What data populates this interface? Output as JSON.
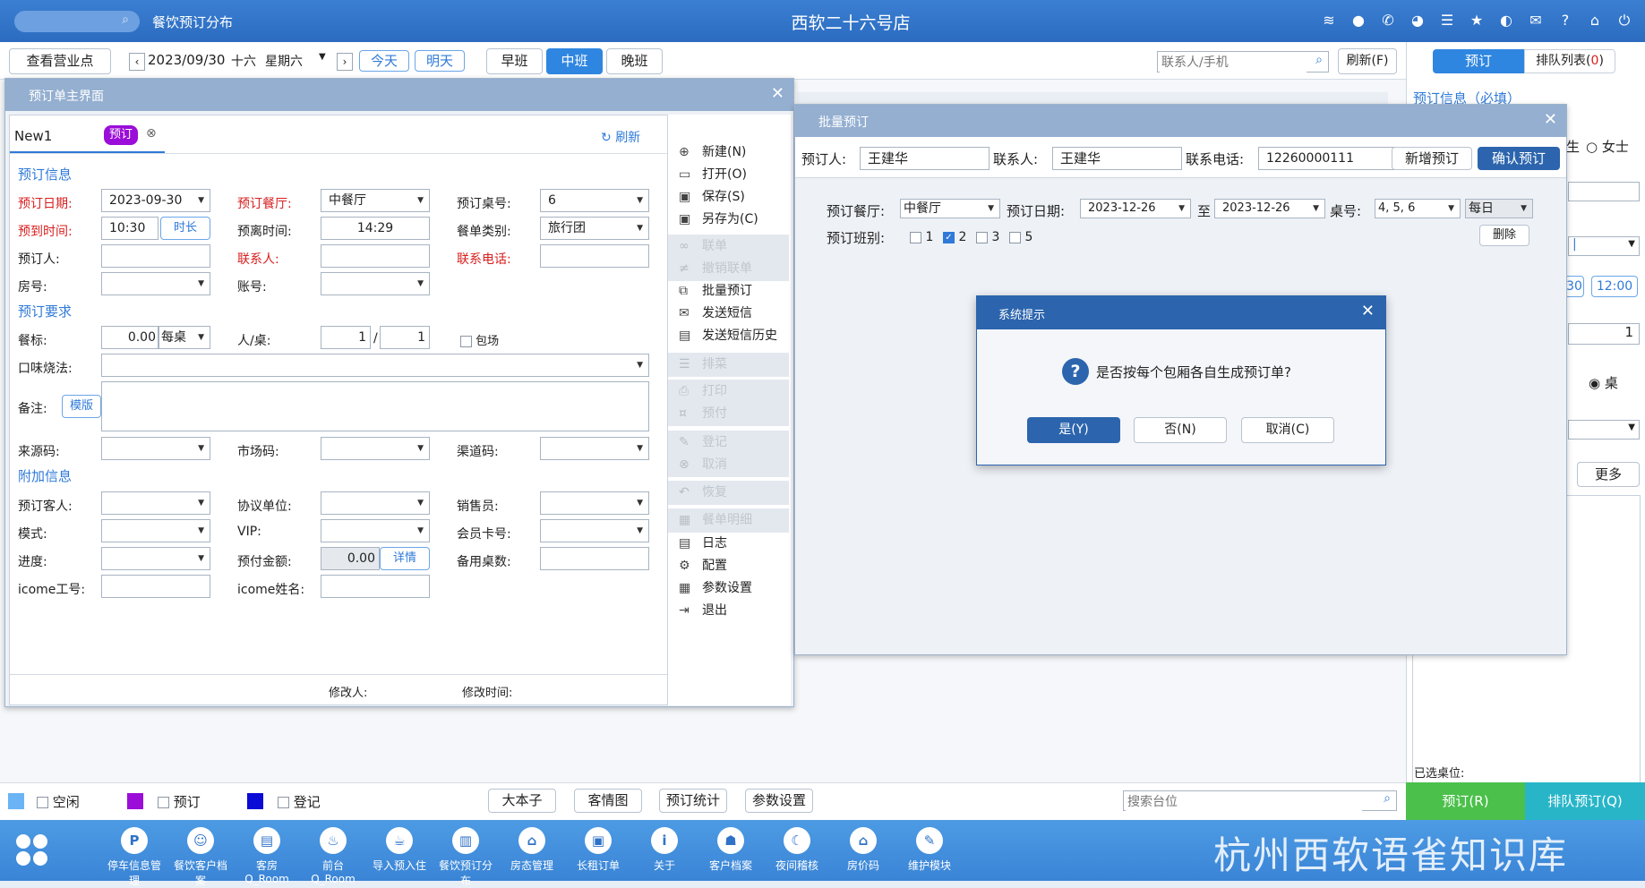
{
  "topbar": {
    "app_title": "餐饮预订分布",
    "store_name": "西软二十六号店",
    "icons": [
      "wifi-icon",
      "chat-icon",
      "phone-icon",
      "palette-icon",
      "list-icon",
      "star-icon",
      "contrast-icon",
      "mail-icon",
      "help-icon",
      "home-icon",
      "power-icon"
    ]
  },
  "toolbar": {
    "view_business": "查看营业点",
    "date": "2023/09/30",
    "lunar": "十六",
    "weekday": "星期六",
    "today": "今天",
    "tomorrow": "明天",
    "shifts": [
      "早班",
      "中班",
      "晚班"
    ],
    "contact_placeholder": "联系人/手机",
    "refresh": "刷新(F)"
  },
  "right_panel": {
    "tab_booking": "预订",
    "tab_queue": "排队列表(",
    "queue_count": "0",
    "tab_queue_close": ")",
    "section": "预订信息（必填）",
    "gender_suffix": "生",
    "female": "女士",
    "time_a": "30",
    "time_b": "12:00",
    "num": "1",
    "table": "桌",
    "more": "更多",
    "selected_tables": "已选桌位:"
  },
  "dlg1": {
    "title": "预订单主界面",
    "tab_name": "New1",
    "tab_badge": "预订",
    "refresh": "刷新",
    "sec_info": "预订信息",
    "date_label": "预订日期:",
    "date_value": "2023-09-30",
    "hall_label": "预订餐厅:",
    "hall_value": "中餐厅",
    "table_label": "预订桌号:",
    "table_value": "6",
    "arrive_label": "预到时间:",
    "arrive_value": "10:30",
    "duration_btn": "时长",
    "leave_label": "预离时间:",
    "leave_value": "14:29",
    "menu_type_label": "餐单类别:",
    "menu_type_value": "旅行团",
    "booker_label": "预订人:",
    "contact_label": "联系人:",
    "phone_label": "联系电话:",
    "room_label": "房号:",
    "account_label": "账号:",
    "sec_req": "预订要求",
    "standard_label": "餐标:",
    "standard_value": "0.00",
    "per_table": "每桌",
    "people_label": "人/桌:",
    "people_a": "1",
    "slash": "/",
    "people_b": "1",
    "private_room": "包场",
    "taste_label": "口味烧法:",
    "remark_label": "备注:",
    "template_btn": "模版",
    "source_label": "来源码:",
    "market_label": "市场码:",
    "channel_label": "渠道码:",
    "sec_extra": "附加信息",
    "guest_label": "预订客人:",
    "agreement_label": "协议单位:",
    "sales_label": "销售员:",
    "mode_label": "模式:",
    "vip_label": "VIP:",
    "member_label": "会员卡号:",
    "progress_label": "进度:",
    "prepaid_label": "预付金额:",
    "prepaid_value": "0.00",
    "detail_btn": "详情",
    "spare_label": "备用桌数:",
    "icome_no_label": "icome工号:",
    "icome_name_label": "icome姓名:",
    "modifier_label": "修改人:",
    "modtime_label": "修改时间:",
    "side_buttons": [
      {
        "label": "新建(N)",
        "icon": "plus-circle-icon",
        "enabled": true
      },
      {
        "label": "打开(O)",
        "icon": "folder-icon",
        "enabled": true
      },
      {
        "label": "保存(S)",
        "icon": "save-icon",
        "enabled": true
      },
      {
        "label": "另存为(C)",
        "icon": "save-as-icon",
        "enabled": true
      },
      {
        "label": "联单",
        "icon": "link-icon",
        "enabled": false
      },
      {
        "label": "撤销联单",
        "icon": "unlink-icon",
        "enabled": false
      },
      {
        "label": "批量预订",
        "icon": "copy-icon",
        "enabled": true
      },
      {
        "label": "发送短信",
        "icon": "mail-icon",
        "enabled": true
      },
      {
        "label": "发送短信历史",
        "icon": "doc-icon",
        "enabled": true
      },
      {
        "label": "排菜",
        "icon": "menu-icon",
        "enabled": false
      },
      {
        "label": "打印",
        "icon": "print-icon",
        "enabled": false
      },
      {
        "label": "预付",
        "icon": "coin-icon",
        "enabled": false
      },
      {
        "label": "登记",
        "icon": "edit-icon",
        "enabled": false
      },
      {
        "label": "取消",
        "icon": "cancel-icon",
        "enabled": false
      },
      {
        "label": "恢复",
        "icon": "undo-icon",
        "enabled": false
      },
      {
        "label": "餐单明细",
        "icon": "clipboard-icon",
        "enabled": false
      },
      {
        "label": "日志",
        "icon": "log-icon",
        "enabled": true
      },
      {
        "label": "配置",
        "icon": "gear-icon",
        "enabled": true
      },
      {
        "label": "参数设置",
        "icon": "settings-icon",
        "enabled": true
      },
      {
        "label": "退出",
        "icon": "exit-icon",
        "enabled": true
      }
    ]
  },
  "dlg2": {
    "title": "批量预订",
    "booker_label": "预订人:",
    "booker_value": "王建华",
    "contact_label": "联系人:",
    "contact_value": "王建华",
    "phone_label": "联系电话:",
    "phone_value": "12260000111",
    "new_btn": "新增预订",
    "confirm_btn": "确认预订",
    "hall_label": "预订餐厅:",
    "hall_value": "中餐厅",
    "date_label": "预订日期:",
    "date_from": "2023-12-26",
    "to": "至",
    "date_to": "2023-12-26",
    "table_label": "桌号:",
    "table_value": "4, 5, 6",
    "freq_value": "每日",
    "shift_label": "预订班别:",
    "shifts": [
      {
        "label": "1",
        "checked": false
      },
      {
        "label": "2",
        "checked": true
      },
      {
        "label": "3",
        "checked": false
      },
      {
        "label": "5",
        "checked": false
      }
    ],
    "delete_btn": "删除"
  },
  "dlg3": {
    "title": "系统提示",
    "message": "是否按每个包厢各自生成预订单?",
    "yes": "是(Y)",
    "no": "否(N)",
    "cancel": "取消(C)"
  },
  "legend": {
    "idle": "空闲",
    "booked": "预订",
    "registered": "登记",
    "idle_color": "#6ab4f5",
    "booked_color": "#9b0dd8",
    "registered_color": "#0b0bd6",
    "buttons": [
      "大本子",
      "客情图",
      "预订统计",
      "参数设置"
    ],
    "search_placeholder": "搜索台位",
    "book_btn": "预订(R)",
    "queue_btn": "排队预订(Q)"
  },
  "dock": [
    {
      "label": "停车信息管理",
      "icon": "parking-icon",
      "glyph": "P"
    },
    {
      "label": "餐饮客户档案",
      "icon": "user-icon",
      "glyph": "☺"
    },
    {
      "label": "客房Q_Room",
      "icon": "room-icon",
      "glyph": "▤"
    },
    {
      "label": "前台Q_Room",
      "icon": "bell-icon",
      "glyph": "♨"
    },
    {
      "label": "导入预入住",
      "icon": "cup-icon",
      "glyph": "☕"
    },
    {
      "label": "餐饮预订分布",
      "icon": "chart-icon",
      "glyph": "▥"
    },
    {
      "label": "房态管理",
      "icon": "house-icon",
      "glyph": "⌂"
    },
    {
      "label": "长租订单",
      "icon": "suitcase-icon",
      "glyph": "▣"
    },
    {
      "label": "关于",
      "icon": "info-icon",
      "glyph": "i"
    },
    {
      "label": "客户档案",
      "icon": "profile-icon",
      "glyph": "☗"
    },
    {
      "label": "夜间稽核",
      "icon": "moon-icon",
      "glyph": "☾"
    },
    {
      "label": "房价码",
      "icon": "price-icon",
      "glyph": "⌂"
    },
    {
      "label": "维护模块",
      "icon": "wrench-icon",
      "glyph": "✎"
    }
  ],
  "watermark": "杭州西软语雀知识库"
}
